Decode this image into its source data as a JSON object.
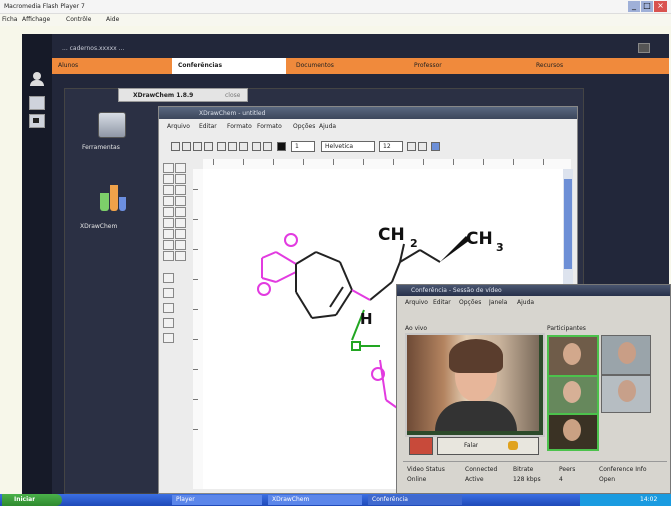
{
  "player": {
    "title": "Macromedia Flash Player 7",
    "menu": [
      "Ficha",
      "Affichage",
      "Contrôle",
      "Aide"
    ],
    "win_buttons": [
      "_",
      "□",
      "×"
    ]
  },
  "app": {
    "title": "... cadernos.xxxxx ...",
    "tabs": [
      "Alunos",
      "Conferências",
      "Documentos",
      "Professor",
      "Recursos"
    ],
    "dock": [
      {
        "label": "Ferramentas",
        "icon": "briefcase-icon"
      },
      {
        "label": "XDrawChem",
        "icon": "flask-icon"
      }
    ],
    "left_rail_icons": [
      "user-icon",
      "document-icon",
      "camera-icon"
    ]
  },
  "xdraw": {
    "tab_label": "XDrawChem 1.8.9",
    "tab_close": "close",
    "window_title": "XDrawChem - untitled",
    "menu": [
      "Arquivo",
      "Editar",
      "Formato",
      "Formato",
      "Opções",
      "Ajuda"
    ],
    "font_name": "Helvetica",
    "font_size": "12",
    "line_width": "1",
    "molecule_labels": {
      "ch2": "CH",
      "ch2_sub": "2",
      "ch3": "CH",
      "ch3_sub": "3",
      "h": "H"
    }
  },
  "video": {
    "title": "Conferência - Sessão de vídeo",
    "menu": [
      "Arquivo",
      "Editar",
      "Opções",
      "Janela",
      "Ajuda"
    ],
    "main_label": "Ao vivo",
    "participants_label": "Participantes",
    "button_label": "Falar",
    "status_labels": [
      "Video Status",
      "Connected",
      "Bitrate",
      "Peers",
      "Conference Info"
    ],
    "status_values": [
      "Online",
      "Active",
      "128 kbps",
      "4",
      "Open"
    ]
  },
  "taskbar": {
    "start": "Iniciar",
    "items": [
      "Player",
      "XDrawChem",
      "Conferência"
    ],
    "clock": "14:02"
  },
  "colors": {
    "tab_orange": "#f08a3c",
    "dark_panel": "#2a2f40",
    "pink": "#e23be0",
    "green": "#22a622",
    "taskbar": "#2a5bd7"
  }
}
